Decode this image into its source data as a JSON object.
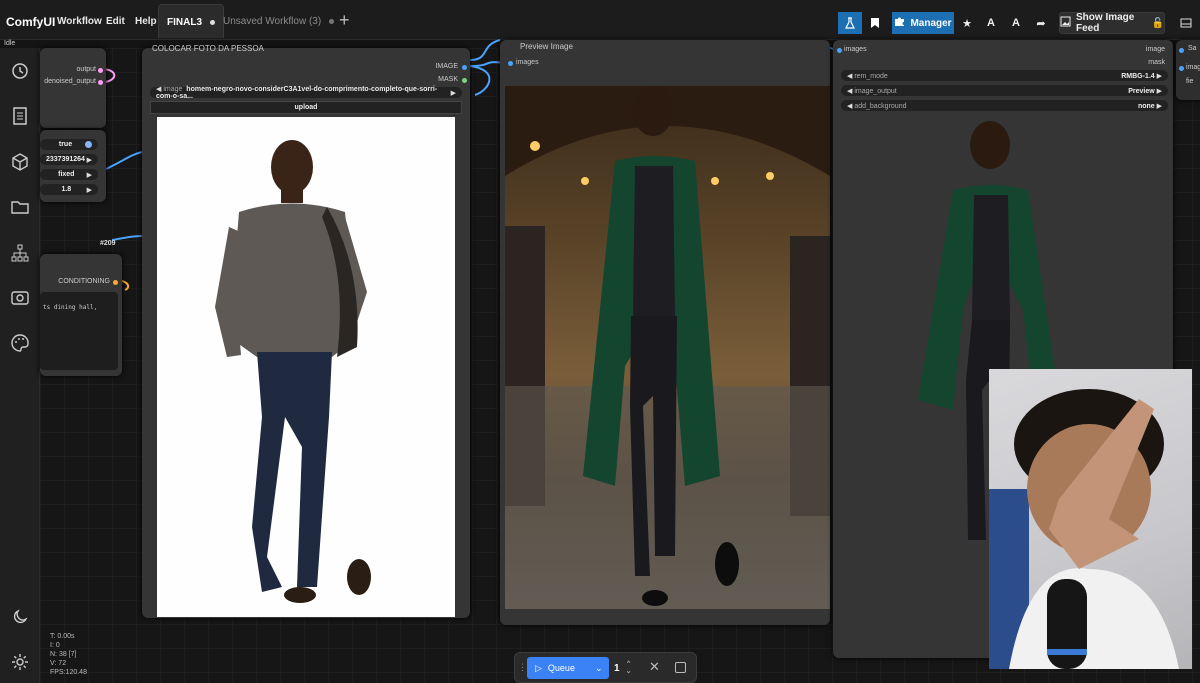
{
  "app": {
    "name": "ComfyUI",
    "status": "Idle"
  },
  "menu": [
    "Workflow",
    "Edit",
    "Help"
  ],
  "tabs": [
    {
      "label": "FINAL3",
      "active": true
    },
    {
      "label": "Unsaved Workflow (3)",
      "active": false
    }
  ],
  "toolbar": {
    "manager_label": "Manager",
    "image_feed_label": "Show Image Feed",
    "icons": [
      "flask-icon",
      "bookmark-icon",
      "puzzle-icon",
      "star-icon",
      "a-icon",
      "a-alt-icon",
      "share-icon",
      "image-feed-icon",
      "panel-icon"
    ]
  },
  "sidebar": {
    "icons": [
      "history-icon",
      "document-icon",
      "cube-icon",
      "folder-icon",
      "tree-icon",
      "image-settings-icon",
      "palette-icon",
      "moon-icon",
      "gear-icon"
    ]
  },
  "nodes": {
    "partial_top_left": {
      "outputs": [
        "output",
        "denoised_output"
      ]
    },
    "settings_node": {
      "widgets": [
        "true",
        "2337391264",
        "fixed",
        "1.8"
      ]
    },
    "link_badge": "#209",
    "conditioning_node": {
      "output": "CONDITIONING",
      "text": "ts dining hall,"
    },
    "load_image": {
      "title": "COLOCAR FOTO DA PESSOA",
      "outputs": [
        "IMAGE",
        "MASK"
      ],
      "image_label": "image",
      "image_value": "homem-negro-novo-considerC3A1vel-do-comprimento-completo-que-sorri-com-o-sa...",
      "upload_label": "upload"
    },
    "preview_image": {
      "title": "Preview Image",
      "input": "images"
    },
    "rmbg": {
      "input": "images",
      "outputs": [
        "image",
        "mask"
      ],
      "widgets": [
        {
          "label": "rem_mode",
          "value": "RMBG-1.4"
        },
        {
          "label": "image_output",
          "value": "Preview"
        },
        {
          "label": "add_background",
          "value": "none"
        }
      ]
    },
    "right_partial": {
      "labels": [
        "Sa",
        "images",
        "fie"
      ]
    }
  },
  "stats": {
    "t": "T: 0.00s",
    "i": "I: 0",
    "n": "N: 38 [7]",
    "v": "V: 72",
    "fps": "FPS:120.48"
  },
  "queue": {
    "label": "Queue",
    "count": "1"
  },
  "colors": {
    "accent": "#1d6fb3",
    "queue_blue": "#3b82f6",
    "image_link": "#4aa3ff",
    "mask_link": "#7fd67f",
    "cond_link": "#ffa931",
    "latent_link": "#ff9cf9"
  }
}
